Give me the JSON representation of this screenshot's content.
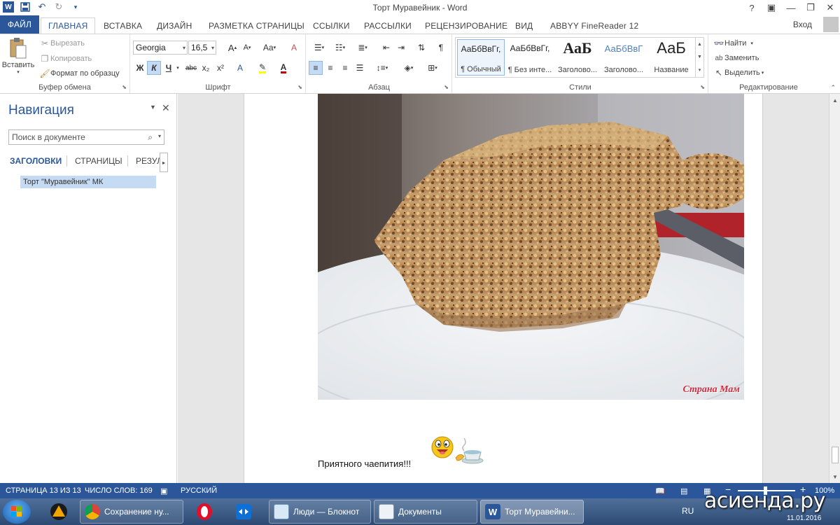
{
  "window": {
    "title": "Торт Муравейник - Word",
    "help": "?",
    "login": "Вход"
  },
  "tabs": [
    "ФАЙЛ",
    "ГЛАВНАЯ",
    "ВСТАВКА",
    "ДИЗАЙН",
    "РАЗМЕТКА СТРАНИЦЫ",
    "ССЫЛКИ",
    "РАССЫЛКИ",
    "РЕЦЕНЗИРОВАНИЕ",
    "ВИД",
    "ABBYY FineReader 12"
  ],
  "ribbon": {
    "clipboard": {
      "label": "Буфер обмена",
      "paste": "Вставить",
      "cut": "Вырезать",
      "copy": "Копировать",
      "format_painter": "Формат по образцу"
    },
    "font": {
      "label": "Шрифт",
      "font_name": "Georgia",
      "font_size": "16,5",
      "grow": "A",
      "shrink": "A",
      "case": "Aa",
      "bold": "Ж",
      "italic": "К",
      "underline": "Ч",
      "strike": "abc",
      "subscript": "x₂",
      "superscript": "x²"
    },
    "paragraph": {
      "label": "Абзац"
    },
    "styles": {
      "label": "Стили",
      "items": [
        {
          "sample": "АаБбВвГг,",
          "name": "¶ Обычный"
        },
        {
          "sample": "АаБбВвГг,",
          "name": "¶ Без инте..."
        },
        {
          "sample": "АаБ",
          "name": "Заголово..."
        },
        {
          "sample": "АаБбВвГ",
          "name": "Заголово..."
        },
        {
          "sample": "АаБ",
          "name": "Название"
        }
      ]
    },
    "editing": {
      "label": "Редактирование",
      "find": "Найти",
      "replace": "Заменить",
      "select": "Выделить"
    }
  },
  "nav": {
    "title": "Навигация",
    "search_placeholder": "Поиск в документе",
    "tabs": [
      "ЗАГОЛОВКИ",
      "СТРАНИЦЫ",
      "РЕЗУЛ"
    ],
    "heading_item": "Торт \"Муравейник\" МК"
  },
  "document": {
    "watermark": "Страна Мам",
    "text": "Приятного чаепития!!!"
  },
  "status": {
    "page": "СТРАНИЦА 13 ИЗ 13",
    "words": "ЧИСЛО СЛОВ: 169",
    "language": "РУССКИЙ",
    "zoom_minus": "−",
    "zoom_plus": "+",
    "zoom": "100%"
  },
  "taskbar": {
    "buttons": [
      "Сохранение ну...",
      "Люди — Блокнот",
      "Документы",
      "Торт Муравейни..."
    ],
    "lang": "RU",
    "date": "11.01.2016"
  },
  "site_watermark": "асиенда.ру"
}
